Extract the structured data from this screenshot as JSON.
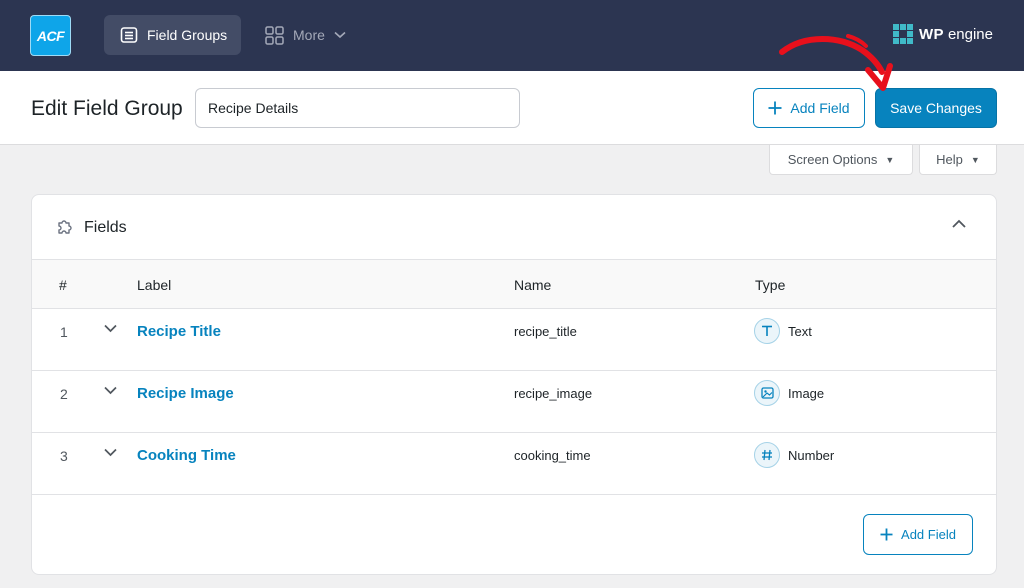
{
  "topbar": {
    "logo_text": "ACF",
    "nav_field_groups": "Field Groups",
    "nav_more": "More",
    "wpengine_bold": "WP",
    "wpengine_rest": "engine"
  },
  "header": {
    "title": "Edit Field Group",
    "group_name_value": "Recipe Details",
    "add_field_label": "Add Field",
    "save_label": "Save Changes"
  },
  "screen_options": {
    "screen_options_label": "Screen Options",
    "help_label": "Help"
  },
  "fields_panel": {
    "title": "Fields",
    "columns": {
      "num": "#",
      "label": "Label",
      "name": "Name",
      "type": "Type"
    },
    "rows": [
      {
        "num": "1",
        "label": "Recipe Title",
        "name": "recipe_title",
        "type": "Text",
        "type_icon": "text-icon"
      },
      {
        "num": "2",
        "label": "Recipe Image",
        "name": "recipe_image",
        "type": "Image",
        "type_icon": "image-icon"
      },
      {
        "num": "3",
        "label": "Cooking Time",
        "name": "cooking_time",
        "type": "Number",
        "type_icon": "number-icon"
      }
    ],
    "add_field_label": "Add Field"
  },
  "colors": {
    "topbar": "#2c3551",
    "accent": "#0783be",
    "annotation_arrow": "#e8101c"
  }
}
